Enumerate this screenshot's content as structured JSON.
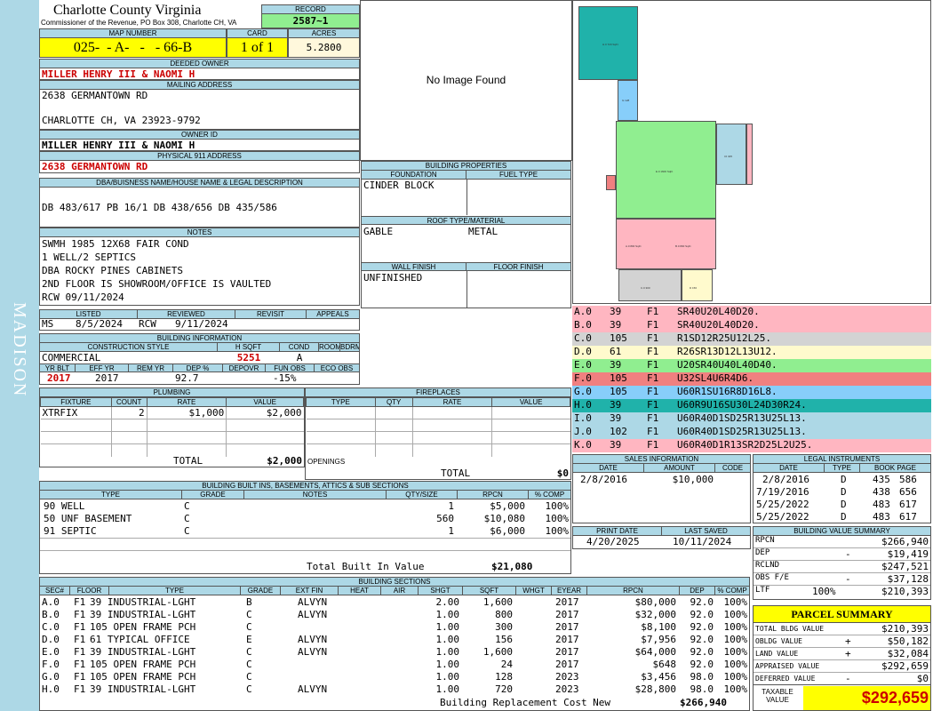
{
  "sidebar": {
    "district": "MADISON"
  },
  "header": {
    "county": "Charlotte County Virginia",
    "commissioner": "Commissioner of the Revenue, PO Box 308, Charlotte CH, VA",
    "record_label": "RECORD",
    "record_value": "2587~1",
    "map_label": "MAP NUMBER",
    "map_value": "025-  - A-   -   - 66-B",
    "card_label": "CARD",
    "card_value": "1 of 1",
    "acres_label": "ACRES",
    "acres_value": "5.2800"
  },
  "owner": {
    "deeded_label": "DEEDED OWNER",
    "deeded_value": "MILLER HENRY III & NAOMI H",
    "mailing_label": "MAILING ADDRESS",
    "mailing_line1": "2638 GERMANTOWN RD",
    "mailing_line2": "CHARLOTTE CH, VA 23923-9792",
    "ownerid_label": "OWNER ID",
    "ownerid_value": "MILLER HENRY III & NAOMI H",
    "physical_label": "PHYSICAL 911 ADDRESS",
    "physical_value": "2638 GERMANTOWN RD",
    "dba_label": "DBA/BUISNESS NAME/HOUSE NAME & LEGAL DESCRIPTION",
    "dba_value": "DB 483/617 PB 16/1 DB 438/656 DB 435/586"
  },
  "notes": {
    "label": "NOTES",
    "lines": [
      "SWMH 1985 12X68 FAIR COND",
      "1 WELL/2 SEPTICS",
      "DBA ROCKY PINES CABINETS",
      "2ND FLOOR IS SHOWROOM/OFFICE IS VAULTED",
      "RCW 09/11/2024"
    ]
  },
  "image": {
    "no_image": "No Image Found"
  },
  "building_properties": {
    "label": "BUILDING PROPERTIES",
    "foundation_label": "FOUNDATION",
    "fuel_label": "FUEL TYPE",
    "foundation_value": "CINDER BLOCK",
    "fuel_value": "",
    "roof_label": "ROOF TYPE/MATERIAL",
    "roof_type": "GABLE",
    "roof_material": "METAL",
    "wall_label": "WALL FINISH",
    "floor_label": "FLOOR FINISH",
    "wall_value": "UNFINISHED",
    "floor_value": ""
  },
  "review": {
    "listed_label": "LISTED",
    "reviewed_label": "REVIEWED",
    "revisit_label": "REVISIT",
    "appeals_label": "APPEALS",
    "listed_by": "MS",
    "listed_date": "8/5/2024",
    "reviewed_by": "RCW",
    "reviewed_date": "9/11/2024"
  },
  "building_info": {
    "label": "BUILDING INFORMATION",
    "style_label": "CONSTRUCTION STYLE",
    "hsqft_label": "H SQFT",
    "cond_label": "COND",
    "rooms_label": "ROOMS",
    "bdrms_label": "BDRMS",
    "style": "COMMERCIAL",
    "hsqft": "5251",
    "cond": "A",
    "yrblt_label": "YR BLT",
    "effyr_label": "EFF YR",
    "remyr_label": "REM YR",
    "dep_label": "DEP %",
    "depovr_label": "DEPOVR",
    "funobs_label": "FUN OBS",
    "ecoobs_label": "ECO OBS",
    "yrblt": "2017",
    "effyr": "2017",
    "dep": "92.7",
    "funobs": "-15%"
  },
  "plumbing": {
    "label": "PLUMBING",
    "cols": [
      "FIXTURE",
      "COUNT",
      "RATE",
      "VALUE"
    ],
    "fixture": "XTRFIX",
    "count": "2",
    "rate": "$1,000",
    "value": "$2,000",
    "total_label": "TOTAL",
    "total": "$2,000"
  },
  "fireplaces": {
    "label": "FIREPLACES",
    "cols": [
      "TYPE",
      "QTY",
      "RATE",
      "VALUE"
    ],
    "openings_label": "OPENINGS",
    "total_label": "TOTAL",
    "total": "$0"
  },
  "sketch_legend": [
    {
      "id": "A.0",
      "code": "39",
      "floor": "F1",
      "desc": "SR40U20L40D20.",
      "color": "#ffb6c1"
    },
    {
      "id": "B.0",
      "code": "39",
      "floor": "F1",
      "desc": "SR40U20L40D20.",
      "color": "#ffb6c1"
    },
    {
      "id": "C.0",
      "code": "105",
      "floor": "F1",
      "desc": "R1SD12R25U12L25.",
      "color": "#d3d3d3"
    },
    {
      "id": "D.0",
      "code": "61",
      "floor": "F1",
      "desc": "R26SR13D12L13U12.",
      "color": "#fffacd"
    },
    {
      "id": "E.0",
      "code": "39",
      "floor": "F1",
      "desc": "U20SR40U40L40D40.",
      "color": "#90ee90"
    },
    {
      "id": "F.0",
      "code": "105",
      "floor": "F1",
      "desc": "U32SL4U6R4D6.",
      "color": "#f08080"
    },
    {
      "id": "G.0",
      "code": "105",
      "floor": "F1",
      "desc": "U60R1SU16R8D16L8.",
      "color": "#87cefa"
    },
    {
      "id": "H.0",
      "code": "39",
      "floor": "F1",
      "desc": "U60R9U16SU30L24D30R24.",
      "color": "#20b2aa"
    },
    {
      "id": "I.0",
      "code": "39",
      "floor": "F1",
      "desc": "U60R40D1SD25R13U25L13.",
      "color": "#add8e6"
    },
    {
      "id": "J.0",
      "code": "102",
      "floor": "F1",
      "desc": "U60R40D1SD25R13U25L13.",
      "color": "#add8e6"
    },
    {
      "id": "K.0",
      "code": "39",
      "floor": "F1",
      "desc": "U60R40D1R13SR2D25L2U25.",
      "color": "#ffb6c1"
    }
  ],
  "sales": {
    "label": "SALES INFORMATION",
    "cols": [
      "DATE",
      "AMOUNT",
      "CODE"
    ],
    "rows": [
      {
        "date": "2/8/2016",
        "amount": "$10,000",
        "code": ""
      }
    ]
  },
  "legal": {
    "label": "LEGAL INSTRUMENTS",
    "cols": [
      "DATE",
      "TYPE",
      "BOOK PAGE"
    ],
    "rows": [
      {
        "date": "2/8/2016",
        "type": "D",
        "book": "435",
        "page": "586"
      },
      {
        "date": "7/19/2016",
        "type": "D",
        "book": "438",
        "page": "656"
      },
      {
        "date": "5/25/2022",
        "type": "D",
        "book": "483",
        "page": "617"
      },
      {
        "date": "5/25/2022",
        "type": "D",
        "book": "483",
        "page": "617"
      }
    ]
  },
  "print": {
    "print_label": "PRINT DATE",
    "saved_label": "LAST SAVED",
    "print_date": "4/20/2025",
    "saved_date": "10/11/2024"
  },
  "builtins": {
    "label": "BUILDING BUILT INS, BASEMENTS, ATTICS & SUB SECTIONS",
    "cols": [
      "TYPE",
      "GRADE",
      "NOTES",
      "QTY/SIZE",
      "RPCN",
      "% COMP"
    ],
    "rows": [
      {
        "type": "90 WELL",
        "grade": "C",
        "notes": "",
        "qty": "1",
        "rpcn": "$5,000",
        "comp": "100%"
      },
      {
        "type": "50 UNF BASEMENT",
        "grade": "C",
        "notes": "",
        "qty": "560",
        "rpcn": "$10,080",
        "comp": "100%"
      },
      {
        "type": "91 SEPTIC",
        "grade": "C",
        "notes": "",
        "qty": "1",
        "rpcn": "$6,000",
        "comp": "100%"
      }
    ],
    "total_label": "Total Built In Value",
    "total": "$21,080"
  },
  "value_summary": {
    "label": "BUILDING VALUE SUMMARY",
    "rows": [
      {
        "label": "RPCN",
        "op": "",
        "value": "$266,940"
      },
      {
        "label": "DEP",
        "op": "-",
        "value": "$19,419"
      },
      {
        "label": "RCLND",
        "op": "",
        "value": "$247,521"
      },
      {
        "label": "OBS F/E",
        "op": "-",
        "value": "$37,128"
      },
      {
        "label": "LTF",
        "op": "100%",
        "value": "$210,393"
      }
    ]
  },
  "parcel": {
    "label": "PARCEL SUMMARY",
    "rows": [
      {
        "label": "TOTAL BLDG VALUE",
        "op": "",
        "value": "$210,393"
      },
      {
        "label": "OBLDG VALUE",
        "op": "+",
        "value": "$50,182"
      },
      {
        "label": "LAND VALUE",
        "op": "+",
        "value": "$32,084"
      },
      {
        "label": "APPRAISED VALUE",
        "op": "",
        "value": "$292,659"
      },
      {
        "label": "DEFERRED VALUE",
        "op": "-",
        "value": "$0"
      }
    ],
    "taxable_label": "TAXABLE VALUE",
    "taxable_value": "$292,659"
  },
  "sections": {
    "label": "BUILDING SECTIONS",
    "cols": [
      "SEC#",
      "FLOOR",
      "TYPE",
      "GRADE",
      "EXT FIN",
      "HEAT",
      "AIR",
      "SHGT",
      "SQFT",
      "WHGT",
      "EYEAR",
      "RPCN",
      "DEP",
      "% COMP"
    ],
    "rows": [
      {
        "sec": "A.0",
        "floor": "F1",
        "type": "39 INDUSTRIAL-LGHT",
        "grade": "B",
        "ext": "ALVYN",
        "heat": "",
        "air": "",
        "shgt": "2.00",
        "sqft": "1,600",
        "whgt": "",
        "eyear": "2017",
        "rpcn": "$80,000",
        "dep": "92.0",
        "comp": "100%"
      },
      {
        "sec": "B.0",
        "floor": "F1",
        "type": "39 INDUSTRIAL-LGHT",
        "grade": "C",
        "ext": "ALVYN",
        "heat": "",
        "air": "",
        "shgt": "1.00",
        "sqft": "800",
        "whgt": "",
        "eyear": "2017",
        "rpcn": "$32,000",
        "dep": "92.0",
        "comp": "100%"
      },
      {
        "sec": "C.0",
        "floor": "F1",
        "type": "105 OPEN FRAME PCH",
        "grade": "C",
        "ext": "",
        "heat": "",
        "air": "",
        "shgt": "1.00",
        "sqft": "300",
        "whgt": "",
        "eyear": "2017",
        "rpcn": "$8,100",
        "dep": "92.0",
        "comp": "100%"
      },
      {
        "sec": "D.0",
        "floor": "F1",
        "type": "61 TYPICAL OFFICE",
        "grade": "E",
        "ext": "ALVYN",
        "heat": "",
        "air": "",
        "shgt": "1.00",
        "sqft": "156",
        "whgt": "",
        "eyear": "2017",
        "rpcn": "$7,956",
        "dep": "92.0",
        "comp": "100%"
      },
      {
        "sec": "E.0",
        "floor": "F1",
        "type": "39 INDUSTRIAL-LGHT",
        "grade": "C",
        "ext": "ALVYN",
        "heat": "",
        "air": "",
        "shgt": "1.00",
        "sqft": "1,600",
        "whgt": "",
        "eyear": "2017",
        "rpcn": "$64,000",
        "dep": "92.0",
        "comp": "100%"
      },
      {
        "sec": "F.0",
        "floor": "F1",
        "type": "105 OPEN FRAME PCH",
        "grade": "C",
        "ext": "",
        "heat": "",
        "air": "",
        "shgt": "1.00",
        "sqft": "24",
        "whgt": "",
        "eyear": "2017",
        "rpcn": "$648",
        "dep": "92.0",
        "comp": "100%"
      },
      {
        "sec": "G.0",
        "floor": "F1",
        "type": "105 OPEN FRAME PCH",
        "grade": "C",
        "ext": "",
        "heat": "",
        "air": "",
        "shgt": "1.00",
        "sqft": "128",
        "whgt": "",
        "eyear": "2023",
        "rpcn": "$3,456",
        "dep": "98.0",
        "comp": "100%"
      },
      {
        "sec": "H.0",
        "floor": "F1",
        "type": "39 INDUSTRIAL-LGHT",
        "grade": "C",
        "ext": "ALVYN",
        "heat": "",
        "air": "",
        "shgt": "1.00",
        "sqft": "720",
        "whgt": "",
        "eyear": "2023",
        "rpcn": "$28,800",
        "dep": "98.0",
        "comp": "100%"
      }
    ],
    "total_label": "Building Replacement Cost New",
    "total": "$266,940"
  }
}
